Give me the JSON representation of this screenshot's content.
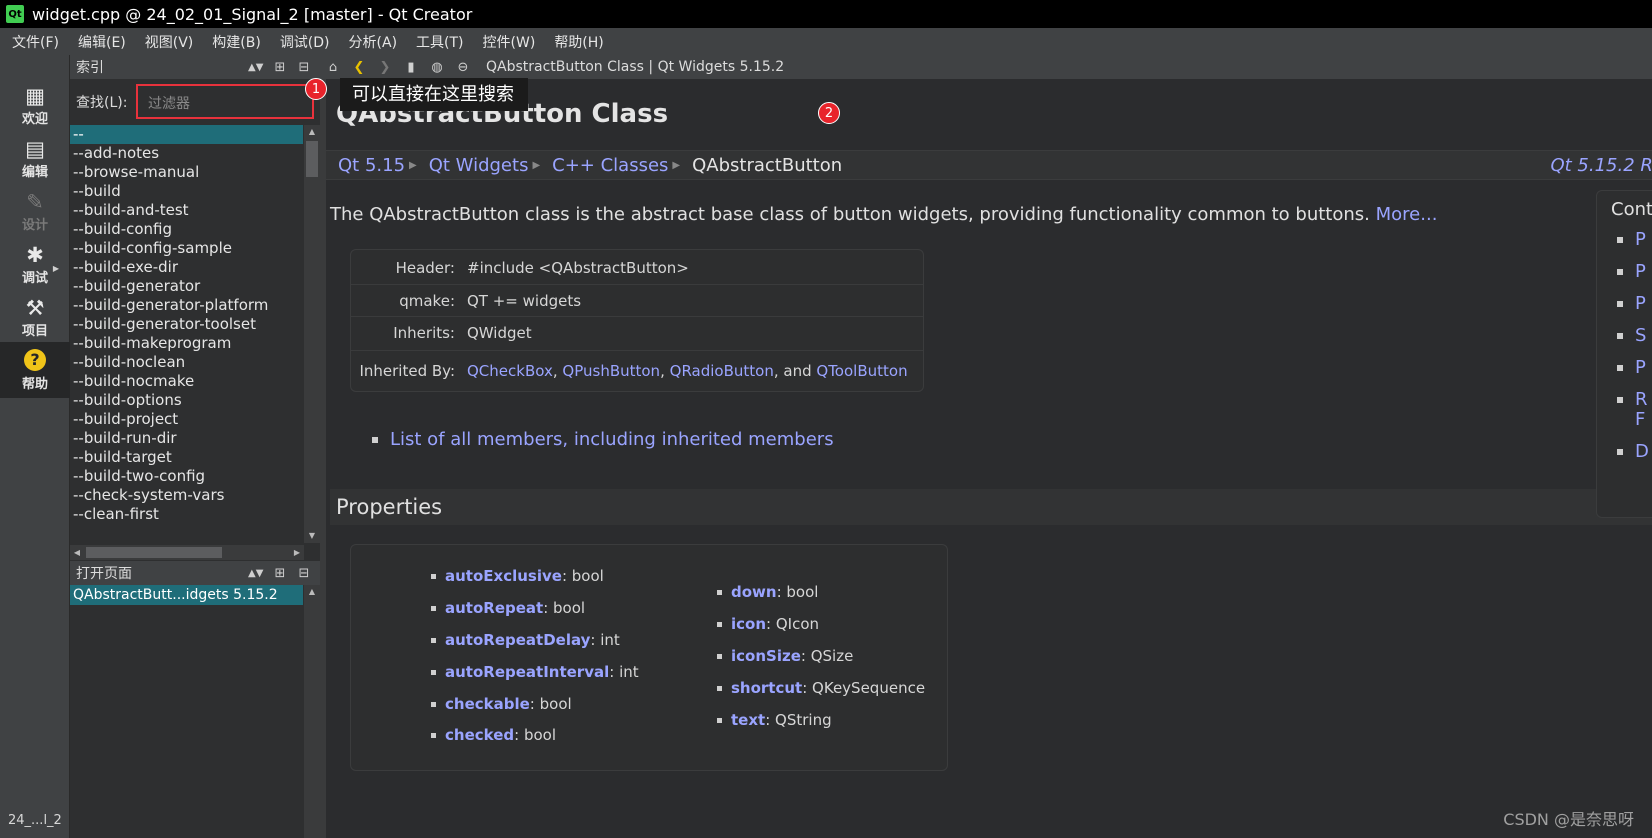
{
  "window": {
    "title": "widget.cpp @ 24_02_01_Signal_2 [master] - Qt Creator",
    "logo_text": "Qt"
  },
  "menu": [
    "文件(F)",
    "编辑(E)",
    "视图(V)",
    "构建(B)",
    "调试(D)",
    "分析(A)",
    "工具(T)",
    "控件(W)",
    "帮助(H)"
  ],
  "modes": [
    {
      "label": "欢迎",
      "icon": "grid-icon",
      "glyph": "▦"
    },
    {
      "label": "编辑",
      "icon": "document-icon",
      "glyph": "▤"
    },
    {
      "label": "设计",
      "icon": "pencil-icon",
      "glyph": "✎"
    },
    {
      "label": "调试",
      "icon": "bug-icon",
      "glyph": "✱"
    },
    {
      "label": "项目",
      "icon": "wrench-icon",
      "glyph": "⚒"
    },
    {
      "label": "帮助",
      "icon": "help-icon",
      "glyph": "?"
    }
  ],
  "target_short": "24_...l_2",
  "index_panel": {
    "title": "索引",
    "find_label": "查找(L):",
    "filter_placeholder": "过滤器",
    "items": [
      "--",
      "--add-notes",
      "--browse-manual",
      "--build",
      "--build-and-test",
      "--build-config",
      "--build-config-sample",
      "--build-exe-dir",
      "--build-generator",
      "--build-generator-platform",
      "--build-generator-toolset",
      "--build-makeprogram",
      "--build-noclean",
      "--build-nocmake",
      "--build-options",
      "--build-project",
      "--build-run-dir",
      "--build-target",
      "--build-two-config",
      "--check-system-vars",
      "--clean-first"
    ]
  },
  "open_pages_panel": {
    "title": "打开页面",
    "items": [
      "QAbstractButt...idgets 5.15.2"
    ]
  },
  "doc_toolbar": {
    "title": "QAbstractButton Class | Qt Widgets 5.15.2"
  },
  "doc": {
    "page_title": "QAbstractButton Class",
    "breadcrumbs": [
      "Qt 5.15",
      "Qt Widgets",
      "C++ Classes",
      "QAbstractButton"
    ],
    "breadcrumb_right": "Qt 5.15.2 Re",
    "brief": "The QAbstractButton class is the abstract base class of button widgets, providing functionality common to buttons.",
    "more_link": "More...",
    "info": {
      "header_key": "Header:",
      "header_val": "#include <QAbstractButton>",
      "qmake_key": "qmake:",
      "qmake_val": "QT += widgets",
      "inherits_key": "Inherits:",
      "inherits_val": "QWidget",
      "inherited_key": "Inherited By:",
      "inherited": [
        "QCheckBox",
        "QPushButton",
        "QRadioButton",
        "QToolButton"
      ],
      "sep_comma": ",",
      "sep_and": ", and"
    },
    "members_link": "List of all members, including inherited members",
    "properties_title": "Properties",
    "properties_left": [
      {
        "name": "autoExclusive",
        "type": " : bool"
      },
      {
        "name": "autoRepeat",
        "type": " : bool"
      },
      {
        "name": "autoRepeatDelay",
        "type": " : int"
      },
      {
        "name": "autoRepeatInterval",
        "type": " : int"
      },
      {
        "name": "checkable",
        "type": " : bool"
      },
      {
        "name": "checked",
        "type": " : bool"
      }
    ],
    "properties_right": [
      {
        "name": "down",
        "type": " : bool"
      },
      {
        "name": "icon",
        "type": " : QIcon"
      },
      {
        "name": "iconSize",
        "type": " : QSize"
      },
      {
        "name": "shortcut",
        "type": " : QKeySequence"
      },
      {
        "name": "text",
        "type": " : QString"
      }
    ],
    "contents_title": "Cont",
    "contents_items": [
      "P",
      "P",
      "P",
      "S",
      "P",
      "R",
      "D"
    ],
    "contents_item_extra": "F"
  },
  "annotations": {
    "badge1": "1",
    "badge2": "2",
    "callout": "可以直接在这里搜索"
  },
  "watermark": "CSDN @是奈思呀",
  "colors": {
    "link": "#9aa4ff",
    "selection": "#1f6d79",
    "annotation": "#e8232b"
  }
}
